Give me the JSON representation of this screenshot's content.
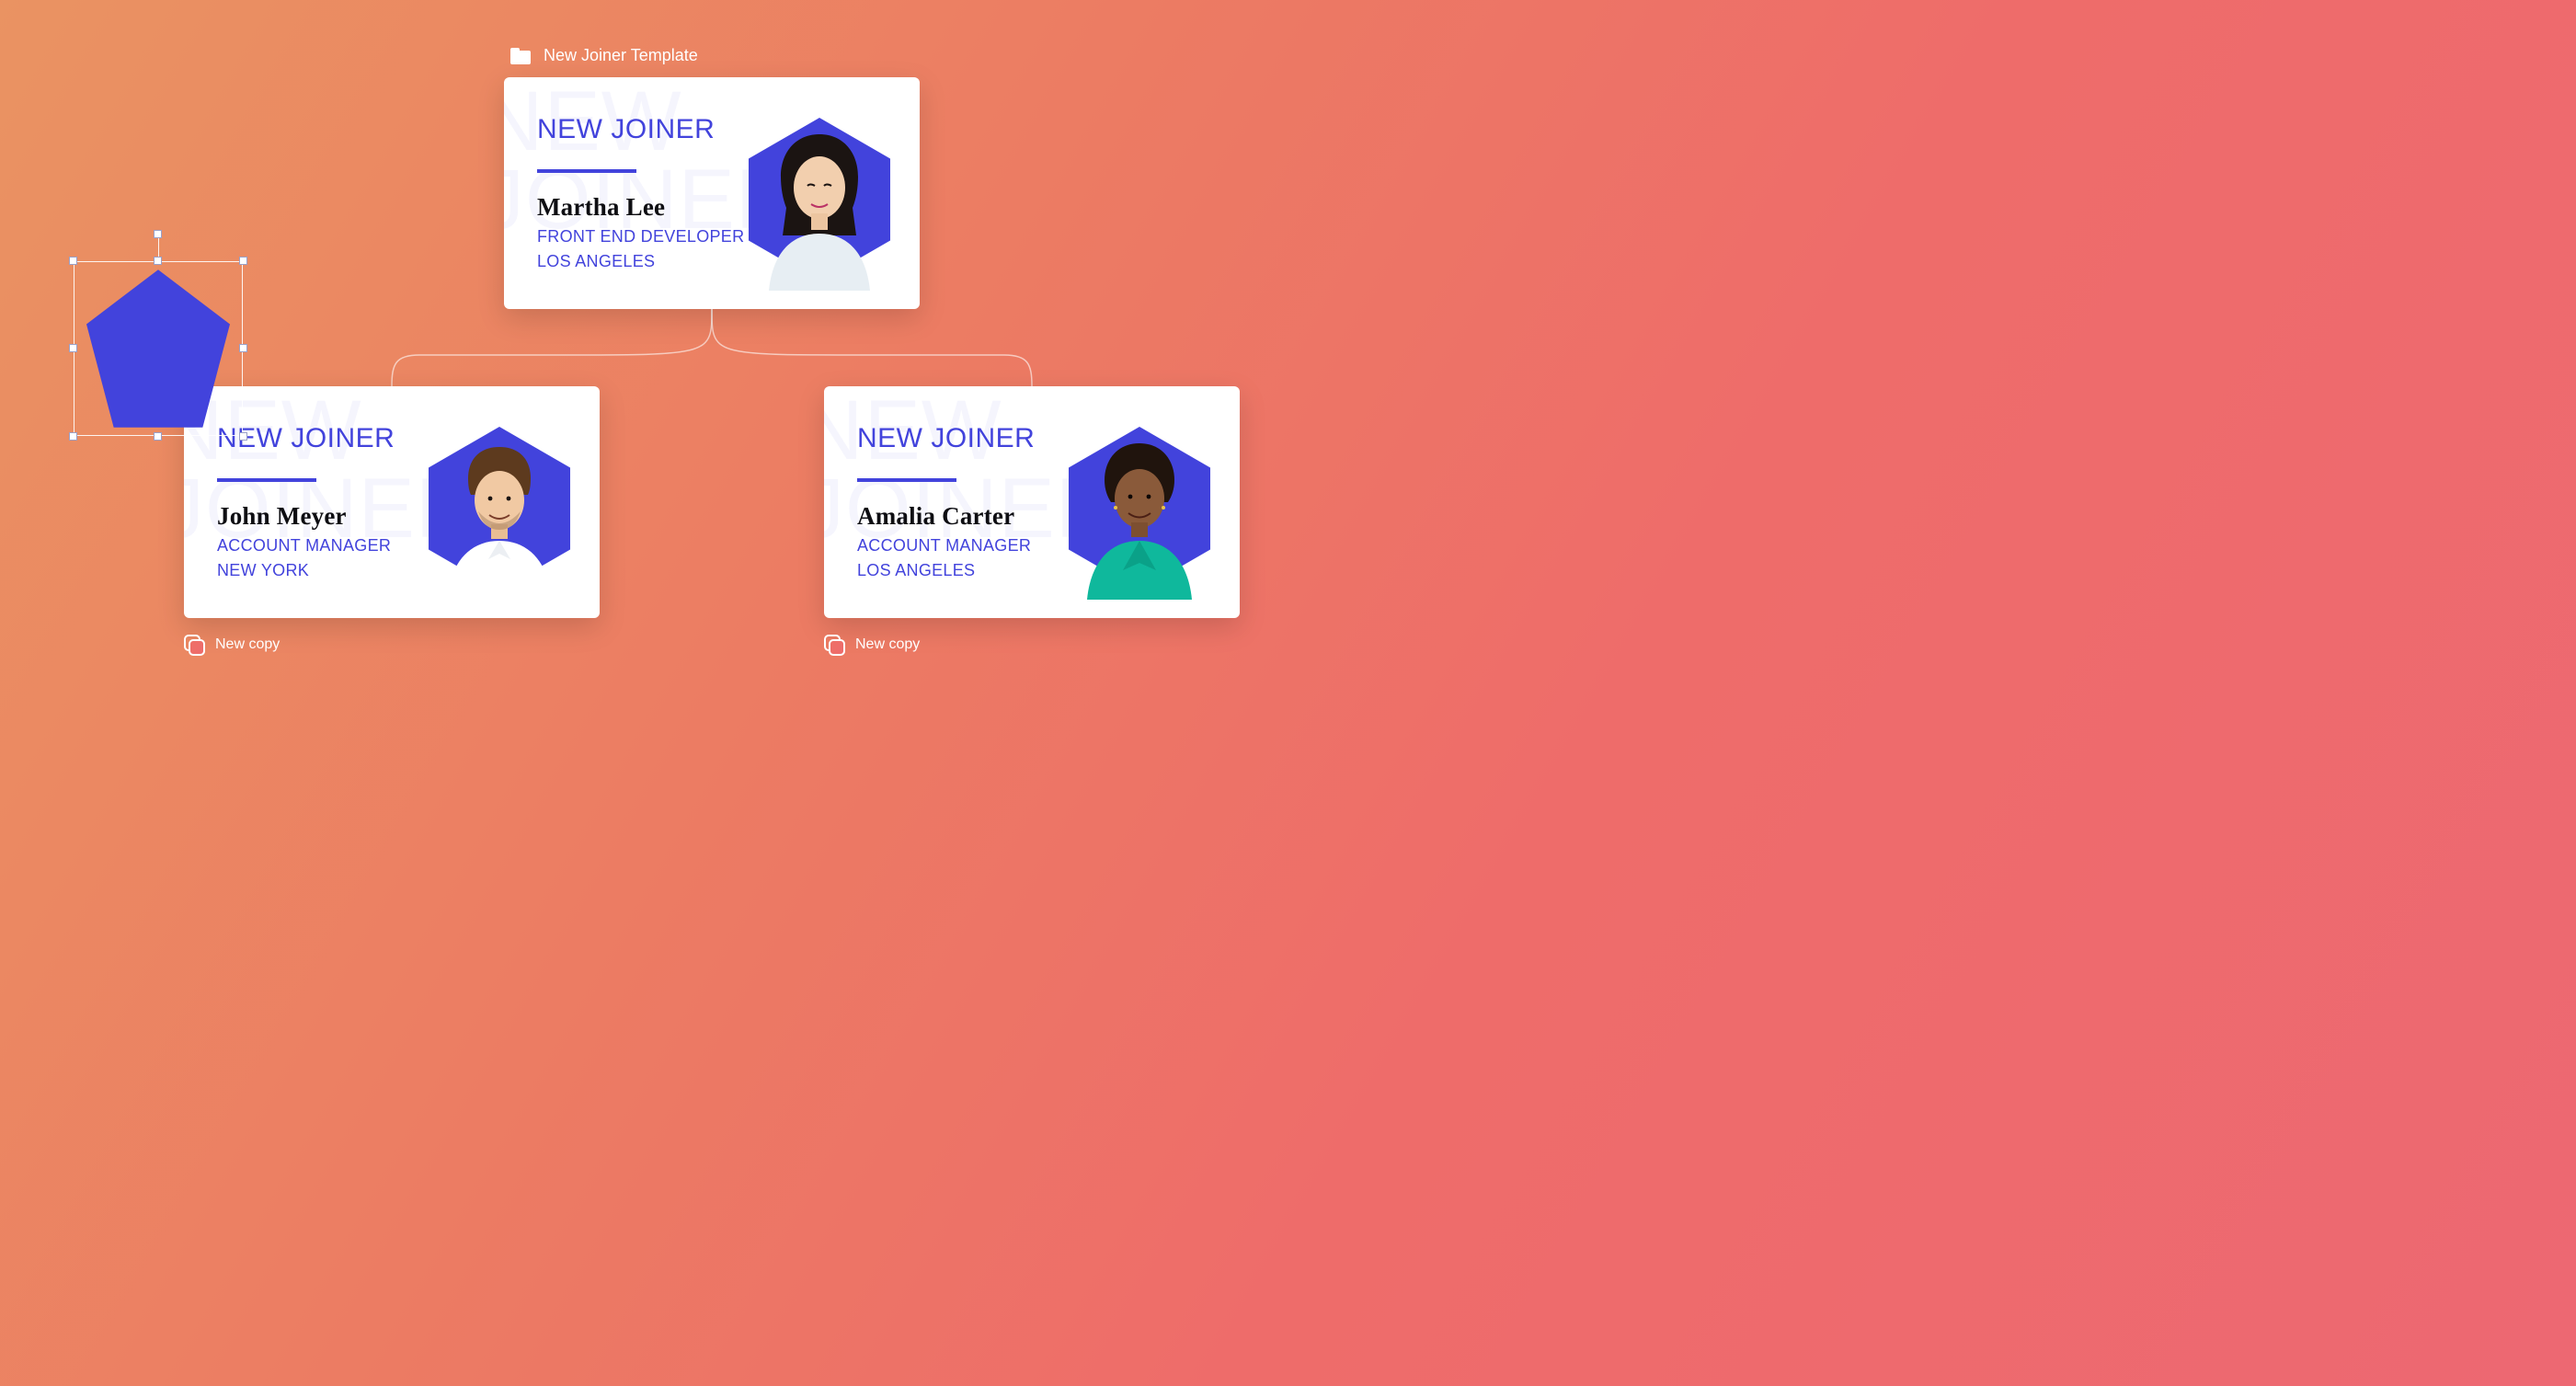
{
  "breadcrumb": {
    "label": "New Joiner Template"
  },
  "cards": {
    "parent": {
      "kicker": "NEW JOINER",
      "watermark": "NEW\nJOINER",
      "name": "Martha Lee",
      "role": "FRONT END DEVELOPER",
      "location": "LOS ANGELES",
      "avatar_desc": "woman-portrait-1"
    },
    "left": {
      "kicker": "NEW JOINER",
      "watermark": "NEW\nJOINER",
      "name": "John Meyer",
      "role": "ACCOUNT MANAGER",
      "location": "NEW YORK",
      "avatar_desc": "man-portrait-1"
    },
    "right": {
      "kicker": "NEW JOINER",
      "watermark": "NEW\nJOINER",
      "name": "Amalia Carter",
      "role": "ACCOUNT MANAGER",
      "location": "LOS ANGELES",
      "avatar_desc": "woman-portrait-2"
    }
  },
  "copy_labels": {
    "left": "New copy",
    "right": "New copy"
  },
  "selected_shape": {
    "type": "pentagon",
    "fill": "#4243dc"
  },
  "colors": {
    "accent": "#4243dc",
    "card_bg": "#ffffff",
    "canvas_gradient_start": "#ea9362",
    "canvas_gradient_end": "#ed6872"
  }
}
